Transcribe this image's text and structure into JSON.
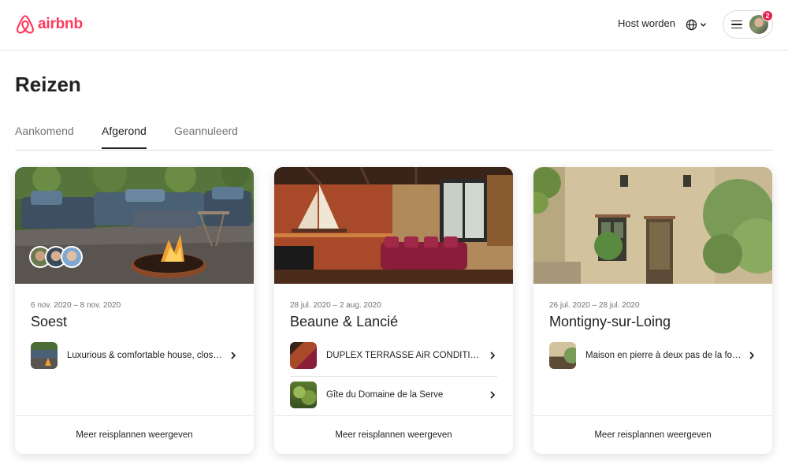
{
  "header": {
    "logo_text": "airbnb",
    "host_link": "Host worden",
    "notification_count": "2",
    "icons": [
      "airbnb-logo-icon",
      "globe-icon",
      "chevron-down-icon",
      "hamburger-icon",
      "avatar"
    ]
  },
  "page_title": "Reizen",
  "tabs": [
    {
      "label": "Aankomend",
      "active": false
    },
    {
      "label": "Afgerond",
      "active": true
    },
    {
      "label": "Geannuleerd",
      "active": false
    }
  ],
  "trips": [
    {
      "dates": "6 nov. 2020 – 8 nov. 2020",
      "city": "Soest",
      "listings": [
        {
          "title": "Luxurious & comfortable house, close to Amsterdam"
        }
      ],
      "footer": "Meer reisplannen weergeven"
    },
    {
      "dates": "28 jul. 2020 – 2 aug. 2020",
      "city": "Beaune & Lancié",
      "listings": [
        {
          "title": "DUPLEX TERRASSE AiR CONDITIONE climatisé"
        },
        {
          "title": "Gîte du Domaine de la Serve"
        }
      ],
      "footer": "Meer reisplannen weergeven"
    },
    {
      "dates": "26 jul. 2020 – 28 jul. 2020",
      "city": "Montigny-sur-Loing",
      "listings": [
        {
          "title": "Maison en pierre à deux pas de la forêt"
        }
      ],
      "footer": "Meer reisplannen weergeven"
    }
  ],
  "colors": {
    "brand": "#ff385c",
    "text": "#222222",
    "muted": "#717171",
    "border": "#dddddd",
    "badge": "#e61e4d"
  }
}
